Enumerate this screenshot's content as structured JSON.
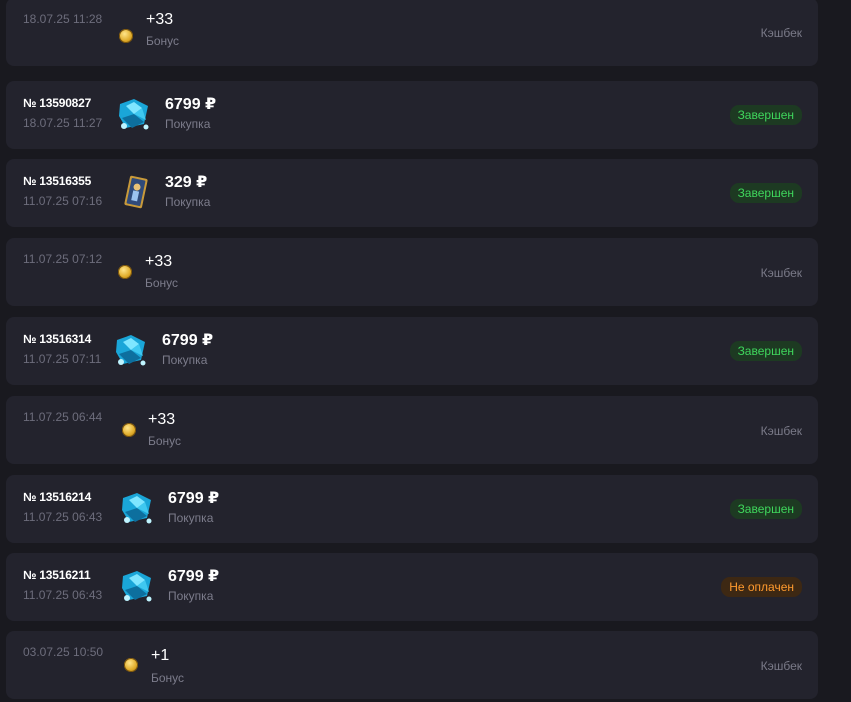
{
  "colors": {
    "background": "#19191f",
    "row_background": "#23232d",
    "completed_badge": "#3fd65c",
    "unpaid_badge": "#ff9a2e",
    "muted_text": "#6d6d7c"
  },
  "transactions": [
    {
      "order": "",
      "date": "18.07.25 11:28",
      "icon": "coin-icon",
      "amount": "+33",
      "type": "Бонус",
      "status": "Кэшбек",
      "status_kind": "cashback"
    },
    {
      "order": "№ 13590827",
      "date": "18.07.25 11:27",
      "icon": "crystal-shard-icon",
      "amount": "6799 ₽",
      "type": "Покупка",
      "status": "Завершен",
      "status_kind": "completed"
    },
    {
      "order": "№ 13516355",
      "date": "11.07.25 07:16",
      "icon": "tarot-card-icon",
      "amount": "329 ₽",
      "type": "Покупка",
      "status": "Завершен",
      "status_kind": "completed"
    },
    {
      "order": "",
      "date": "11.07.25 07:12",
      "icon": "coin-icon",
      "amount": "+33",
      "type": "Бонус",
      "status": "Кэшбек",
      "status_kind": "cashback"
    },
    {
      "order": "№ 13516314",
      "date": "11.07.25 07:11",
      "icon": "crystal-shard-icon",
      "amount": "6799 ₽",
      "type": "Покупка",
      "status": "Завершен",
      "status_kind": "completed"
    },
    {
      "order": "",
      "date": "11.07.25 06:44",
      "icon": "coin-icon",
      "amount": "+33",
      "type": "Бонус",
      "status": "Кэшбек",
      "status_kind": "cashback"
    },
    {
      "order": "№ 13516214",
      "date": "11.07.25 06:43",
      "icon": "crystal-shard-icon",
      "amount": "6799 ₽",
      "type": "Покупка",
      "status": "Завершен",
      "status_kind": "completed"
    },
    {
      "order": "№ 13516211",
      "date": "11.07.25 06:43",
      "icon": "crystal-shard-icon",
      "amount": "6799 ₽",
      "type": "Покупка",
      "status": "Не оплачен",
      "status_kind": "unpaid"
    },
    {
      "order": "",
      "date": "03.07.25 10:50",
      "icon": "coin-icon",
      "amount": "+1",
      "type": "Бонус",
      "status": "Кэшбек",
      "status_kind": "cashback"
    }
  ]
}
